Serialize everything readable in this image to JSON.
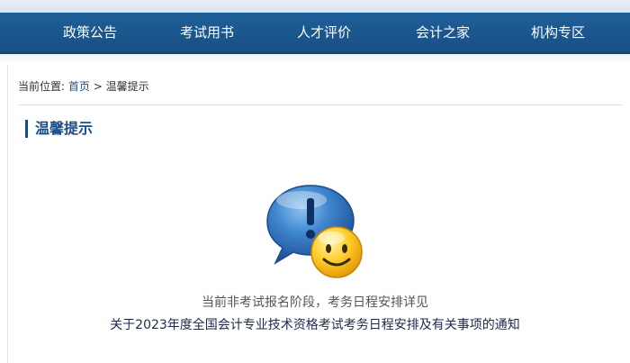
{
  "nav": {
    "items": [
      {
        "label": "政策公告"
      },
      {
        "label": "考试用书"
      },
      {
        "label": "人才评价"
      },
      {
        "label": "会计之家"
      },
      {
        "label": "机构专区"
      }
    ]
  },
  "breadcrumb": {
    "prefix": "当前位置:",
    "home": "首页",
    "separator": ">",
    "current": "温馨提示"
  },
  "section": {
    "title": "温馨提示"
  },
  "notice": {
    "line1": "当前非考试报名阶段，考务日程安排详见",
    "link": "关于2023年度全国会计专业技术资格考试考务日程安排及有关事项的通知"
  },
  "icons": {
    "illustration": "speech-bubble-exclamation-smiley-icon"
  },
  "colors": {
    "nav_bg": "#1f5f98",
    "title_accent": "#1a4d86"
  }
}
